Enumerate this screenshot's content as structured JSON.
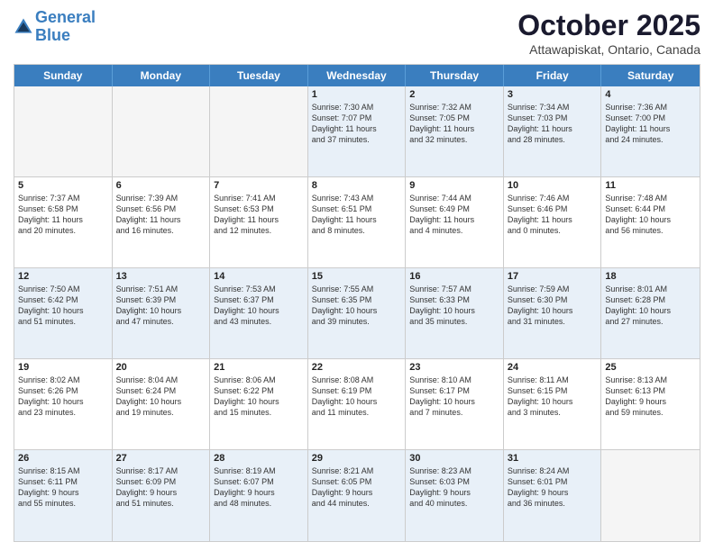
{
  "header": {
    "logo_line1": "General",
    "logo_line2": "Blue",
    "month": "October 2025",
    "location": "Attawapiskat, Ontario, Canada"
  },
  "day_headers": [
    "Sunday",
    "Monday",
    "Tuesday",
    "Wednesday",
    "Thursday",
    "Friday",
    "Saturday"
  ],
  "weeks": [
    [
      {
        "num": "",
        "info": "",
        "empty": true
      },
      {
        "num": "",
        "info": "",
        "empty": true
      },
      {
        "num": "",
        "info": "",
        "empty": true
      },
      {
        "num": "1",
        "info": "Sunrise: 7:30 AM\nSunset: 7:07 PM\nDaylight: 11 hours\nand 37 minutes."
      },
      {
        "num": "2",
        "info": "Sunrise: 7:32 AM\nSunset: 7:05 PM\nDaylight: 11 hours\nand 32 minutes."
      },
      {
        "num": "3",
        "info": "Sunrise: 7:34 AM\nSunset: 7:03 PM\nDaylight: 11 hours\nand 28 minutes."
      },
      {
        "num": "4",
        "info": "Sunrise: 7:36 AM\nSunset: 7:00 PM\nDaylight: 11 hours\nand 24 minutes."
      }
    ],
    [
      {
        "num": "5",
        "info": "Sunrise: 7:37 AM\nSunset: 6:58 PM\nDaylight: 11 hours\nand 20 minutes."
      },
      {
        "num": "6",
        "info": "Sunrise: 7:39 AM\nSunset: 6:56 PM\nDaylight: 11 hours\nand 16 minutes."
      },
      {
        "num": "7",
        "info": "Sunrise: 7:41 AM\nSunset: 6:53 PM\nDaylight: 11 hours\nand 12 minutes."
      },
      {
        "num": "8",
        "info": "Sunrise: 7:43 AM\nSunset: 6:51 PM\nDaylight: 11 hours\nand 8 minutes."
      },
      {
        "num": "9",
        "info": "Sunrise: 7:44 AM\nSunset: 6:49 PM\nDaylight: 11 hours\nand 4 minutes."
      },
      {
        "num": "10",
        "info": "Sunrise: 7:46 AM\nSunset: 6:46 PM\nDaylight: 11 hours\nand 0 minutes."
      },
      {
        "num": "11",
        "info": "Sunrise: 7:48 AM\nSunset: 6:44 PM\nDaylight: 10 hours\nand 56 minutes."
      }
    ],
    [
      {
        "num": "12",
        "info": "Sunrise: 7:50 AM\nSunset: 6:42 PM\nDaylight: 10 hours\nand 51 minutes."
      },
      {
        "num": "13",
        "info": "Sunrise: 7:51 AM\nSunset: 6:39 PM\nDaylight: 10 hours\nand 47 minutes."
      },
      {
        "num": "14",
        "info": "Sunrise: 7:53 AM\nSunset: 6:37 PM\nDaylight: 10 hours\nand 43 minutes."
      },
      {
        "num": "15",
        "info": "Sunrise: 7:55 AM\nSunset: 6:35 PM\nDaylight: 10 hours\nand 39 minutes."
      },
      {
        "num": "16",
        "info": "Sunrise: 7:57 AM\nSunset: 6:33 PM\nDaylight: 10 hours\nand 35 minutes."
      },
      {
        "num": "17",
        "info": "Sunrise: 7:59 AM\nSunset: 6:30 PM\nDaylight: 10 hours\nand 31 minutes."
      },
      {
        "num": "18",
        "info": "Sunrise: 8:01 AM\nSunset: 6:28 PM\nDaylight: 10 hours\nand 27 minutes."
      }
    ],
    [
      {
        "num": "19",
        "info": "Sunrise: 8:02 AM\nSunset: 6:26 PM\nDaylight: 10 hours\nand 23 minutes."
      },
      {
        "num": "20",
        "info": "Sunrise: 8:04 AM\nSunset: 6:24 PM\nDaylight: 10 hours\nand 19 minutes."
      },
      {
        "num": "21",
        "info": "Sunrise: 8:06 AM\nSunset: 6:22 PM\nDaylight: 10 hours\nand 15 minutes."
      },
      {
        "num": "22",
        "info": "Sunrise: 8:08 AM\nSunset: 6:19 PM\nDaylight: 10 hours\nand 11 minutes."
      },
      {
        "num": "23",
        "info": "Sunrise: 8:10 AM\nSunset: 6:17 PM\nDaylight: 10 hours\nand 7 minutes."
      },
      {
        "num": "24",
        "info": "Sunrise: 8:11 AM\nSunset: 6:15 PM\nDaylight: 10 hours\nand 3 minutes."
      },
      {
        "num": "25",
        "info": "Sunrise: 8:13 AM\nSunset: 6:13 PM\nDaylight: 9 hours\nand 59 minutes."
      }
    ],
    [
      {
        "num": "26",
        "info": "Sunrise: 8:15 AM\nSunset: 6:11 PM\nDaylight: 9 hours\nand 55 minutes."
      },
      {
        "num": "27",
        "info": "Sunrise: 8:17 AM\nSunset: 6:09 PM\nDaylight: 9 hours\nand 51 minutes."
      },
      {
        "num": "28",
        "info": "Sunrise: 8:19 AM\nSunset: 6:07 PM\nDaylight: 9 hours\nand 48 minutes."
      },
      {
        "num": "29",
        "info": "Sunrise: 8:21 AM\nSunset: 6:05 PM\nDaylight: 9 hours\nand 44 minutes."
      },
      {
        "num": "30",
        "info": "Sunrise: 8:23 AM\nSunset: 6:03 PM\nDaylight: 9 hours\nand 40 minutes."
      },
      {
        "num": "31",
        "info": "Sunrise: 8:24 AM\nSunset: 6:01 PM\nDaylight: 9 hours\nand 36 minutes."
      },
      {
        "num": "",
        "info": "",
        "empty": true
      }
    ]
  ],
  "alt_rows": [
    0,
    2,
    4
  ]
}
